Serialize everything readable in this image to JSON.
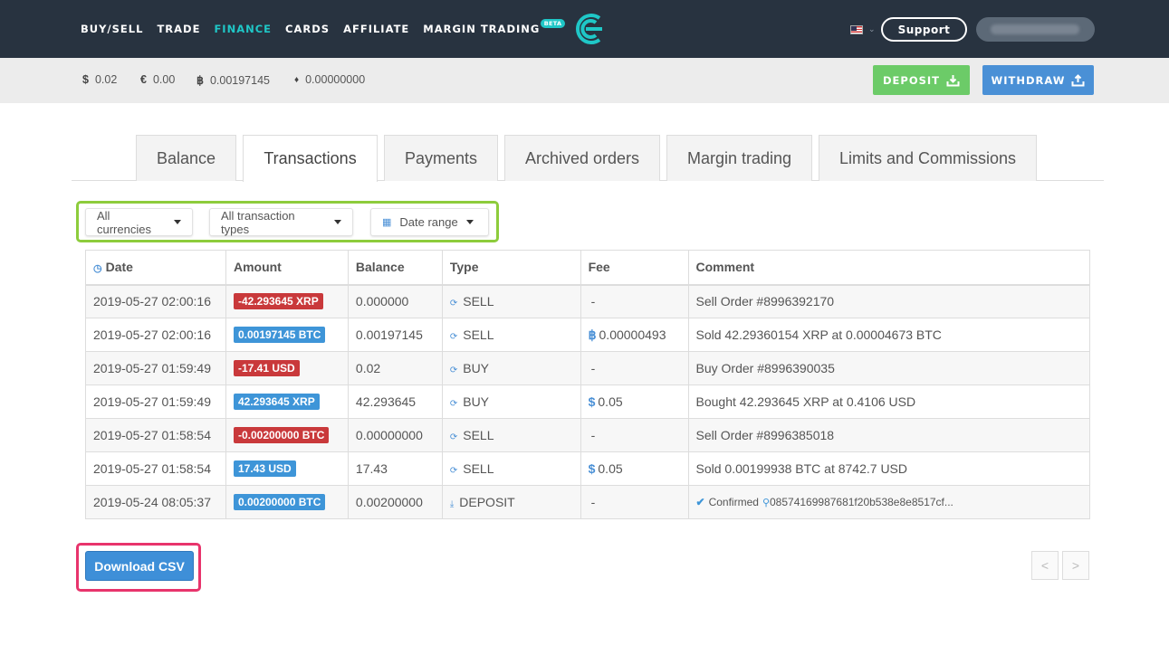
{
  "nav": {
    "items": [
      {
        "label": "BUY/SELL",
        "active": false
      },
      {
        "label": "TRADE",
        "active": false
      },
      {
        "label": "FINANCE",
        "active": true
      },
      {
        "label": "CARDS",
        "active": false
      },
      {
        "label": "AFFILIATE",
        "active": false
      },
      {
        "label": "MARGIN TRADING",
        "active": false,
        "badge": "BETA"
      }
    ],
    "support_label": "Support",
    "logo_icon": "cex-logo-icon",
    "flag_icon": "us-flag-icon"
  },
  "balances": [
    {
      "symbol": "$",
      "value": "0.02"
    },
    {
      "symbol": "€",
      "value": "0.00"
    },
    {
      "symbol": "฿",
      "value": "0.00197145"
    },
    {
      "symbol": "♦",
      "value": "0.00000000"
    }
  ],
  "actions": {
    "deposit_label": "DEPOSIT",
    "withdraw_label": "WITHDRAW"
  },
  "tabs": [
    {
      "label": "Balance",
      "active": false
    },
    {
      "label": "Transactions",
      "active": true
    },
    {
      "label": "Payments",
      "active": false
    },
    {
      "label": "Archived orders",
      "active": false
    },
    {
      "label": "Margin trading",
      "active": false
    },
    {
      "label": "Limits and Commissions",
      "active": false
    }
  ],
  "filters": {
    "currency": "All currencies",
    "type": "All transaction types",
    "date": "Date range"
  },
  "table": {
    "headers": {
      "date": "Date",
      "amount": "Amount",
      "balance": "Balance",
      "type": "Type",
      "fee": "Fee",
      "comment": "Comment"
    },
    "rows": [
      {
        "date": "2019-05-27 02:00:16",
        "amount": "-42.293645 XRP",
        "sign": "neg",
        "balance": "0.000000",
        "type": "SELL",
        "fee_symbol": "",
        "fee": "-",
        "comment": "Sell Order #8996392170"
      },
      {
        "date": "2019-05-27 02:00:16",
        "amount": "0.00197145 BTC",
        "sign": "pos",
        "balance": "0.00197145",
        "type": "SELL",
        "fee_symbol": "฿",
        "fee": "0.00000493",
        "comment": "Sold 42.29360154 XRP at 0.00004673 BTC"
      },
      {
        "date": "2019-05-27 01:59:49",
        "amount": "-17.41 USD",
        "sign": "neg",
        "balance": "0.02",
        "type": "BUY",
        "fee_symbol": "",
        "fee": "-",
        "comment": "Buy Order #8996390035"
      },
      {
        "date": "2019-05-27 01:59:49",
        "amount": "42.293645 XRP",
        "sign": "pos",
        "balance": "42.293645",
        "type": "BUY",
        "fee_symbol": "$",
        "fee": "0.05",
        "comment": "Bought 42.293645 XRP at 0.4106 USD"
      },
      {
        "date": "2019-05-27 01:58:54",
        "amount": "-0.00200000 BTC",
        "sign": "neg",
        "balance": "0.00000000",
        "type": "SELL",
        "fee_symbol": "",
        "fee": "-",
        "comment": "Sell Order #8996385018"
      },
      {
        "date": "2019-05-27 01:58:54",
        "amount": "17.43 USD",
        "sign": "pos",
        "balance": "17.43",
        "type": "SELL",
        "fee_symbol": "$",
        "fee": "0.05",
        "comment": "Sold 0.00199938 BTC at 8742.7 USD"
      },
      {
        "date": "2019-05-24 08:05:37",
        "amount": "0.00200000 BTC",
        "sign": "pos",
        "balance": "0.00200000",
        "type": "DEPOSIT",
        "fee_symbol": "",
        "fee": "-",
        "comment_status": "Confirmed",
        "comment_hash": "08574169987681f20b538e8e8517cf..."
      }
    ]
  },
  "download_label": "Download CSV",
  "pagination": {
    "prev": "<",
    "next": ">"
  },
  "colors": {
    "nav_bg": "#283340",
    "accent": "#1fc7c7",
    "deposit": "#6ccb68",
    "withdraw": "#4a90d6",
    "negative": "#c9393b",
    "positive": "#3e95d8",
    "highlight_green": "#8dcc3c",
    "highlight_pink": "#e8346c"
  }
}
